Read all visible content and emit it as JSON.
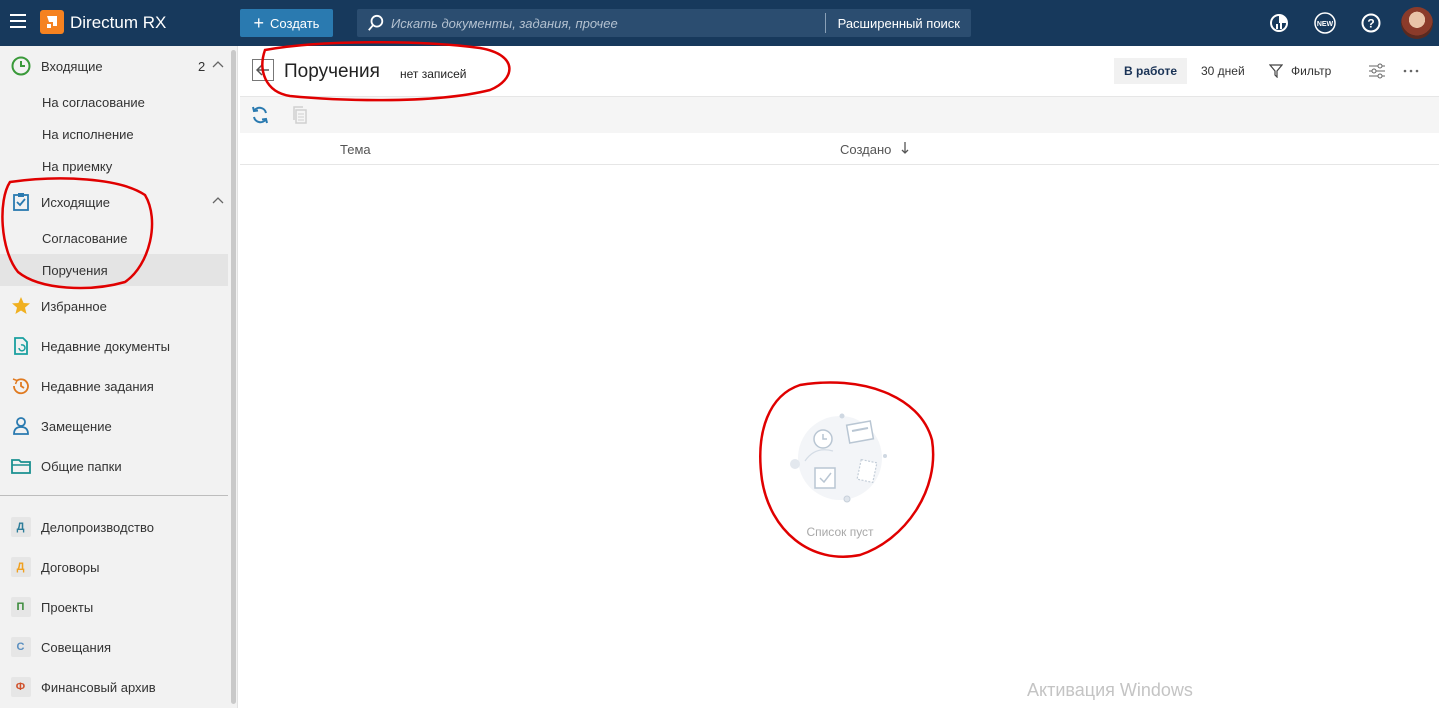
{
  "header": {
    "app_title": "Directum RX",
    "create_label": "Создать",
    "search_placeholder": "Искать документы, задания, прочее",
    "advanced_search_label": "Расширенный поиск",
    "icons": [
      "menu-icon",
      "directum-logo-icon",
      "plus-icon",
      "search-icon",
      "chart-icon",
      "new-icon",
      "help-icon",
      "user-avatar"
    ],
    "new_badge": "NEW"
  },
  "sidebar": {
    "groups": [
      {
        "label": "Входящие",
        "count": "2",
        "icon": "clock-icon"
      },
      {
        "label": "Исходящие",
        "icon": "checklist-icon"
      }
    ],
    "incoming_items": [
      "На согласование",
      "На исполнение",
      "На приемку"
    ],
    "outgoing_items": [
      "Согласование",
      "Поручения"
    ],
    "active_item": "Поручения",
    "links": [
      {
        "label": "Избранное",
        "icon": "star-icon"
      },
      {
        "label": "Недавние документы",
        "icon": "recent-document-icon"
      },
      {
        "label": "Недавние задания",
        "icon": "recent-tasks-icon"
      },
      {
        "label": "Замещение",
        "icon": "person-icon"
      },
      {
        "label": "Общие папки",
        "icon": "folder-icon"
      }
    ],
    "modules": [
      {
        "letter": "Д",
        "label": "Делопроизводство",
        "color": "#2e7d9a"
      },
      {
        "letter": "Д",
        "label": "Договоры",
        "color": "#f0a020"
      },
      {
        "letter": "П",
        "label": "Проекты",
        "color": "#3a8a3a"
      },
      {
        "letter": "С",
        "label": "Совещания",
        "color": "#5a8fc0"
      },
      {
        "letter": "Ф",
        "label": "Финансовый архив",
        "color": "#d0502a"
      }
    ]
  },
  "main": {
    "title": "Поручения",
    "record_count": "нет записей",
    "toolbar": {
      "in_work": "В работе",
      "period": "30 дней",
      "filter": "Фильтр"
    },
    "columns": [
      "Тема",
      "Создано"
    ],
    "sort_column": "Создано",
    "sort_direction": "descending",
    "empty_text": "Список пуст"
  },
  "watermark": "Активация Windows",
  "colors": {
    "topbar": "#17395c",
    "create_button": "#2a7ab0",
    "logo": "#f58220",
    "annotation": "#e00000"
  }
}
